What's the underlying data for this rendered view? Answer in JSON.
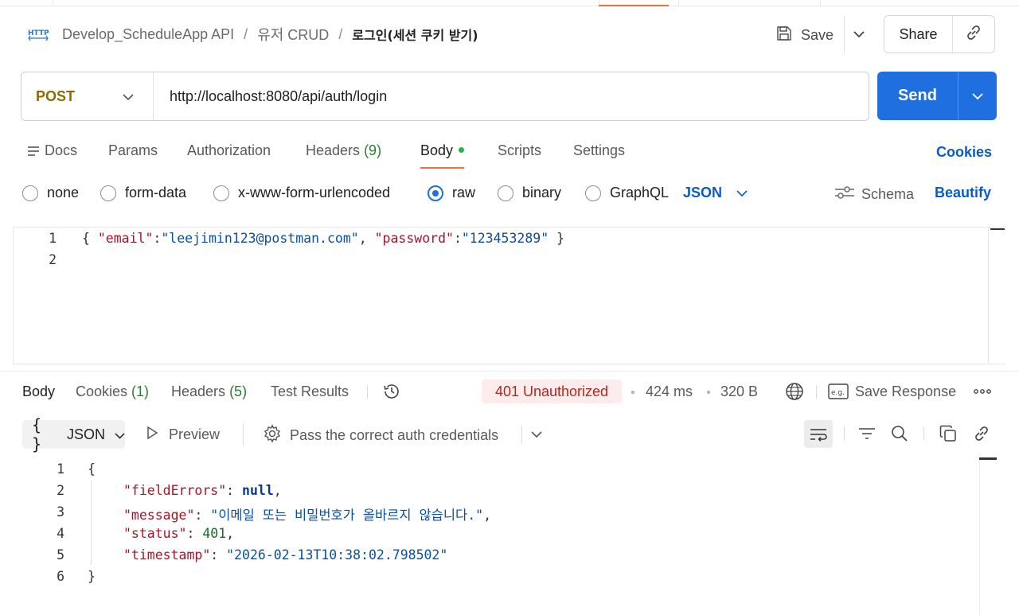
{
  "breadcrumb": {
    "icon": "http-icon",
    "collection": "Develop_ScheduleApp API",
    "folder": "유저 CRUD",
    "request": "로그인(세션 쿠키 받기)"
  },
  "header": {
    "save_label": "Save",
    "share_label": "Share"
  },
  "request": {
    "method": "POST",
    "url": "http://localhost:8080/api/auth/login",
    "send_label": "Send"
  },
  "request_tabs": {
    "docs": "Docs",
    "params": "Params",
    "authorization": "Authorization",
    "headers": "Headers",
    "headers_count": "(9)",
    "body": "Body",
    "scripts": "Scripts",
    "settings": "Settings",
    "cookies": "Cookies"
  },
  "body_types": {
    "none": "none",
    "form_data": "form-data",
    "urlencoded": "x-www-form-urlencoded",
    "raw": "raw",
    "binary": "binary",
    "graphql": "GraphQL",
    "selected": "raw",
    "language": "JSON",
    "schema": "Schema",
    "beautify": "Beautify"
  },
  "request_body": {
    "line_numbers": [
      "1",
      "2"
    ],
    "brace_open": "{ ",
    "key_email": "\"email\"",
    "colon": ":",
    "val_email": "\"leejimin123@postman.com\"",
    "comma": ", ",
    "key_password": "\"password\"",
    "val_password": "\"123453289\"",
    "brace_close": " }"
  },
  "response_tabs": {
    "body": "Body",
    "cookies": "Cookies",
    "cookies_count": "(1)",
    "headers": "Headers",
    "headers_count": "(5)",
    "test_results": "Test Results"
  },
  "response_meta": {
    "status": "401 Unauthorized",
    "time": "424 ms",
    "size": "320 B",
    "save_response": "Save Response"
  },
  "response_toolbar": {
    "format": "JSON",
    "preview": "Preview",
    "test_description": "Pass the correct auth credentials"
  },
  "response_body": {
    "line_numbers": [
      "1",
      "2",
      "3",
      "4",
      "5",
      "6"
    ],
    "open": "{",
    "close": "}",
    "k1": "\"fieldErrors\"",
    "v1": "null",
    "k2": "\"message\"",
    "v2": "\"이메일 또는 비밀번호가 올바르지 않습니다.\"",
    "k3": "\"status\"",
    "v3": "401",
    "k4": "\"timestamp\"",
    "v4": "\"2026-02-13T10:38:02.798502\"",
    "sep": ": ",
    "comma": ","
  },
  "colors": {
    "accent": "#ff6c37",
    "send": "#1f6fe0",
    "link": "#0a5bc4",
    "method_post": "#8a6d00",
    "status_error_bg": "#fdeceb",
    "status_error_text": "#b3261e"
  }
}
